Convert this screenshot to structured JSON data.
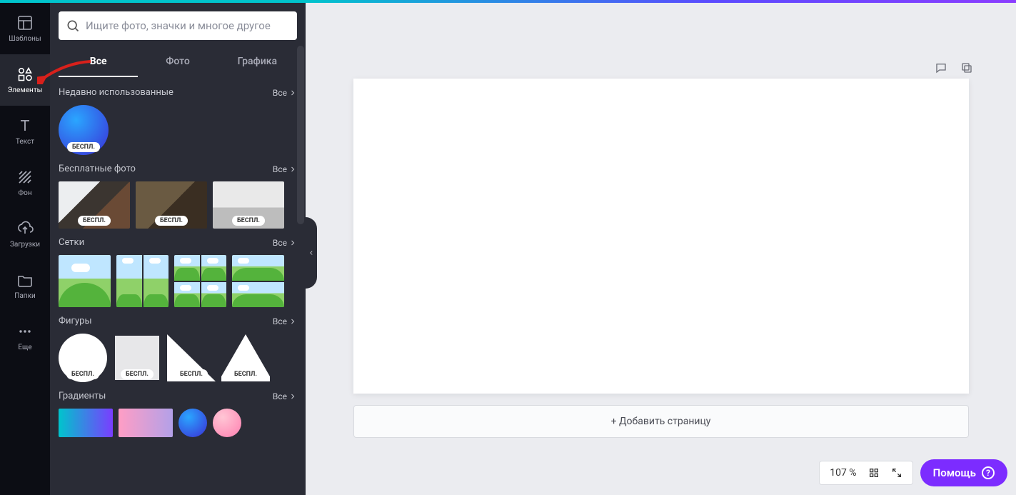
{
  "nav": {
    "templates": "Шаблоны",
    "elements": "Элементы",
    "text": "Текст",
    "background": "Фон",
    "uploads": "Загрузки",
    "folders": "Папки",
    "more": "Еще"
  },
  "search": {
    "placeholder": "Ищите фото, значки и многое другое"
  },
  "tabs": {
    "all": "Все",
    "photo": "Фото",
    "graphics": "Графика"
  },
  "sections": {
    "recent": {
      "title": "Недавно использованные",
      "all": "Все"
    },
    "freePhotos": {
      "title": "Бесплатные фото",
      "all": "Все"
    },
    "grids": {
      "title": "Сетки",
      "all": "Все"
    },
    "shapes": {
      "title": "Фигуры",
      "all": "Все"
    },
    "gradients": {
      "title": "Градиенты",
      "all": "Все"
    }
  },
  "badge": {
    "free": "БЕСПЛ."
  },
  "canvas": {
    "addPage": "+ Добавить страницу"
  },
  "footer": {
    "zoom": "107 %",
    "help": "Помощь"
  }
}
